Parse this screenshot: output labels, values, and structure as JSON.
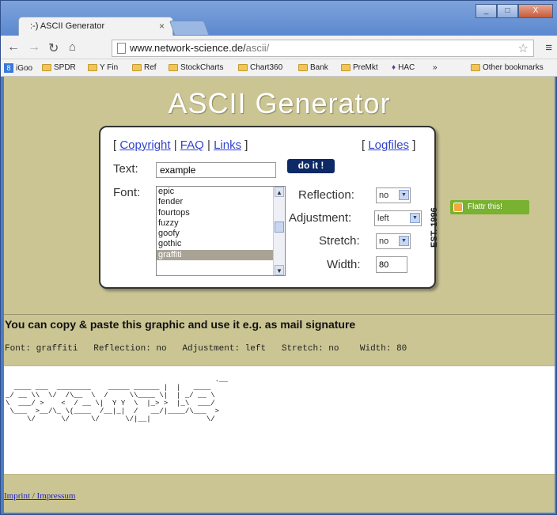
{
  "browser": {
    "tab_title": ":-) ASCII Generator",
    "tab_close": "×",
    "url_host": "www.network-science.de/",
    "url_path": "ascii/",
    "bookmarks": [
      "iGoo",
      "SPDR",
      "Y Fin",
      "Ref",
      "StockCharts",
      "Chart360",
      "Bank",
      "PreMkt",
      "HAC",
      "»",
      "Other bookmarks"
    ],
    "window_buttons": [
      "_",
      "□",
      "X"
    ]
  },
  "page": {
    "title": "ASCII Generator",
    "links": {
      "copyright": "Copyright",
      "faq": "FAQ",
      "links": "Links",
      "logfiles": "Logfiles",
      "lb": "[",
      "rb": "]",
      "sep": "|"
    },
    "text_label": "Text:",
    "text_value": "example",
    "doit": "do it !",
    "font_label": "Font:",
    "fonts": [
      "epic",
      "fender",
      "fourtops",
      "fuzzy",
      "goofy",
      "gothic",
      "graffiti"
    ],
    "selected_font": "graffiti",
    "reflection_label": "Reflection:",
    "reflection_value": "no",
    "adjustment_label": "Adjustment:",
    "adjustment_value": "left",
    "stretch_label": "Stretch:",
    "stretch_value": "no",
    "width_label": "Width:",
    "width_value": "80",
    "est": "EST. 1996",
    "flattr": "Flattr this!",
    "copy_note": "You can copy & paste this graphic and use it e.g. as mail signature",
    "params_line": "Font: graffiti   Reflection: no   Adjustment: left   Stretch: no    Width: 80",
    "ascii_art": "                                                 .__\n  ____ ___  ________    _____ ______ |  |   ____\n_/ __ \\\\  \\/  /\\__  \\  /     \\\\____ \\|  | _/ __ \\\n\\  ___/ >    <  / __ \\|  Y Y  \\  |_> >  |_\\  ___/\n \\___  >__/\\_ \\(____  /__|_|  /   __/|____/\\___  >\n     \\/      \\/     \\/      \\/|__|             \\/",
    "footer": "Imprint / Impressum"
  },
  "colors": {
    "olive": "#cbc594",
    "link": "#3344cc",
    "doit_bg": "#0d2a66",
    "flattr": "#79b131"
  }
}
